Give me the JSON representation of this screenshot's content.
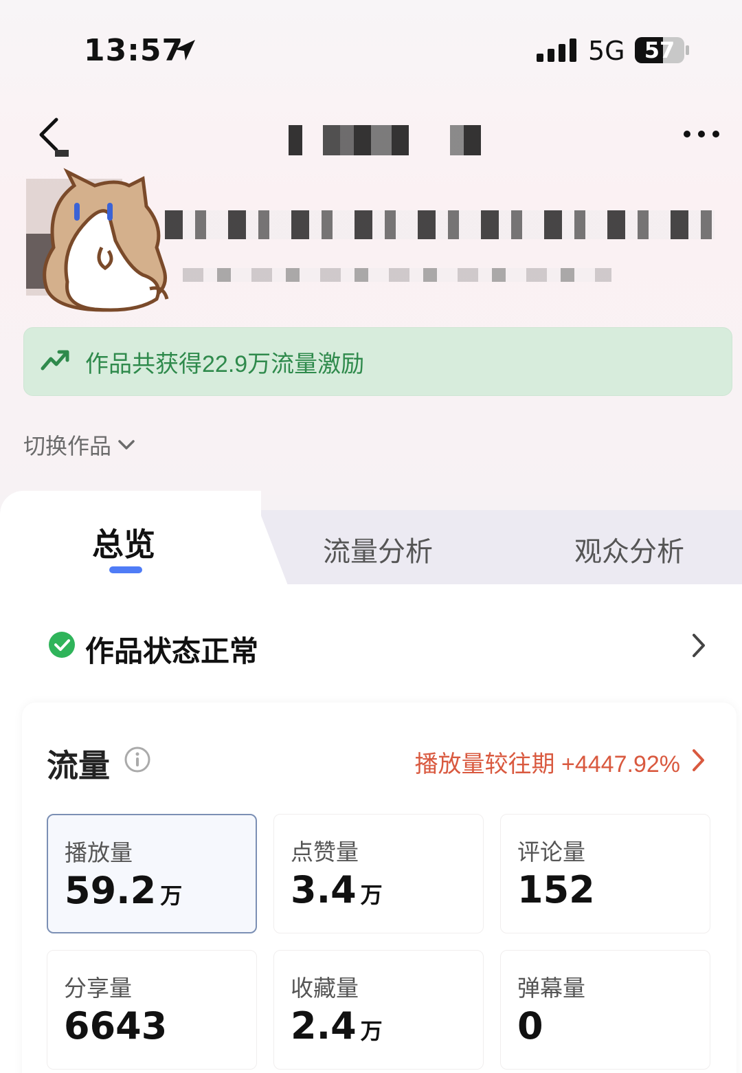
{
  "status_bar": {
    "time": "13:57",
    "network": "5G",
    "battery": "57",
    "battery_level": 0.57
  },
  "nav": {
    "back_icon": "chevron-left-icon",
    "more_icon": "more-horizontal-icon"
  },
  "incentive": {
    "text": "作品共获得22.9万流量激励",
    "color": "#2f8a4c"
  },
  "switch_work": {
    "label": "切换作品"
  },
  "tabs": [
    {
      "label": "总览",
      "active": true
    },
    {
      "label": "流量分析",
      "active": false
    },
    {
      "label": "观众分析",
      "active": false
    }
  ],
  "work_status": {
    "text": "作品状态正常",
    "status_color": "#2fb45a"
  },
  "traffic": {
    "title": "流量",
    "compare_text": "播放量较往期 +4447.92%",
    "compare_color": "#d9593f",
    "metrics": [
      {
        "label": "播放量",
        "value": "59.2",
        "unit": "万",
        "selected": true
      },
      {
        "label": "点赞量",
        "value": "3.4",
        "unit": "万",
        "selected": false
      },
      {
        "label": "评论量",
        "value": "152",
        "unit": "",
        "selected": false
      },
      {
        "label": "分享量",
        "value": "6643",
        "unit": "",
        "selected": false
      },
      {
        "label": "收藏量",
        "value": "2.4",
        "unit": "万",
        "selected": false
      },
      {
        "label": "弹幕量",
        "value": "0",
        "unit": "",
        "selected": false
      }
    ]
  },
  "colors": {
    "accent_blue": "#4f7cf6",
    "selected_border": "#7b8fb4"
  }
}
